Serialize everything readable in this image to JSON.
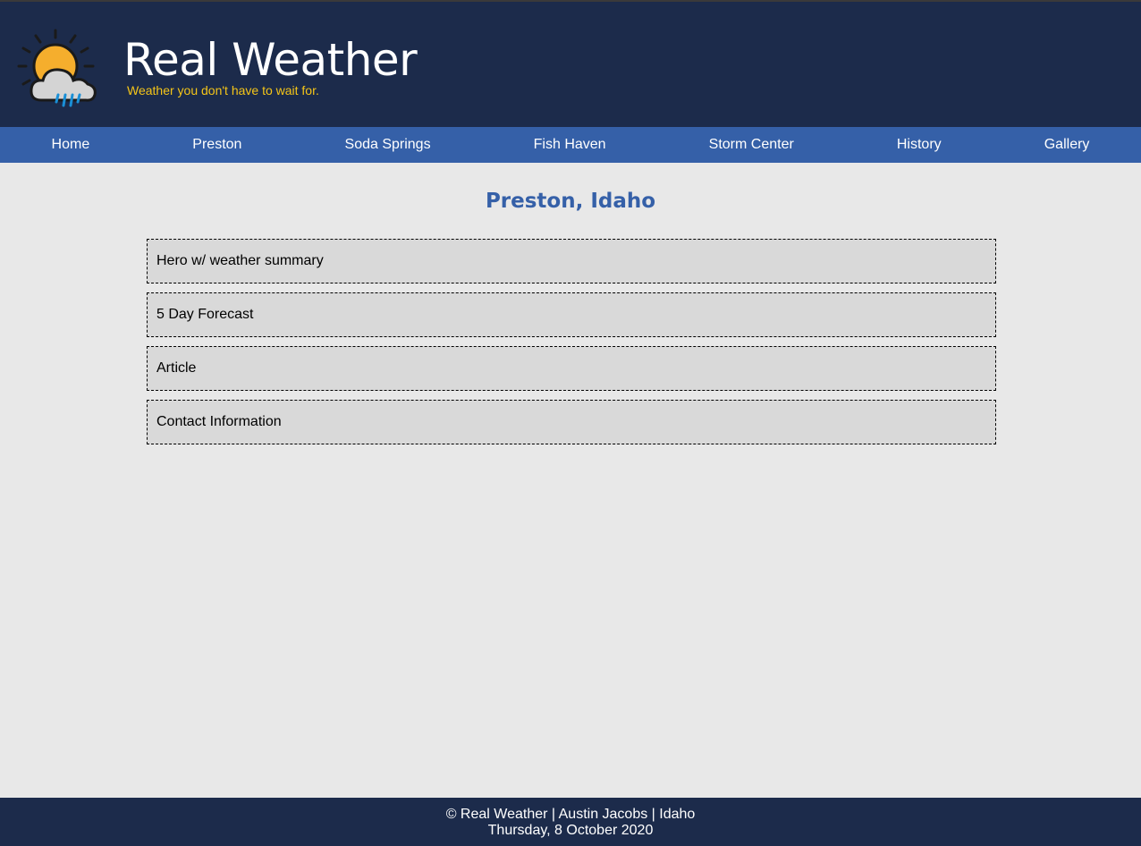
{
  "header": {
    "title": "Real Weather",
    "tagline": "Weather you don't have to wait for.",
    "logo_icon": "sun-cloud-rain-icon"
  },
  "nav": {
    "items": [
      {
        "label": "Home"
      },
      {
        "label": "Preston"
      },
      {
        "label": "Soda Springs"
      },
      {
        "label": "Fish Haven"
      },
      {
        "label": "Storm Center"
      },
      {
        "label": "History"
      },
      {
        "label": "Gallery"
      }
    ]
  },
  "main": {
    "page_title": "Preston, Idaho",
    "sections": [
      {
        "label": "Hero w/ weather summary"
      },
      {
        "label": "5 Day Forecast"
      },
      {
        "label": "Article"
      },
      {
        "label": "Contact Information"
      }
    ]
  },
  "footer": {
    "credits": "© Real Weather | Austin Jacobs | Idaho",
    "date": "Thursday, 8 October 2020"
  },
  "colors": {
    "header_bg": "#1c2b4b",
    "nav_bg": "#3560a8",
    "tagline": "#f5c518",
    "page_bg": "#e8e8e8",
    "section_bg": "#d9d9d9",
    "title_accent": "#3560a8"
  }
}
